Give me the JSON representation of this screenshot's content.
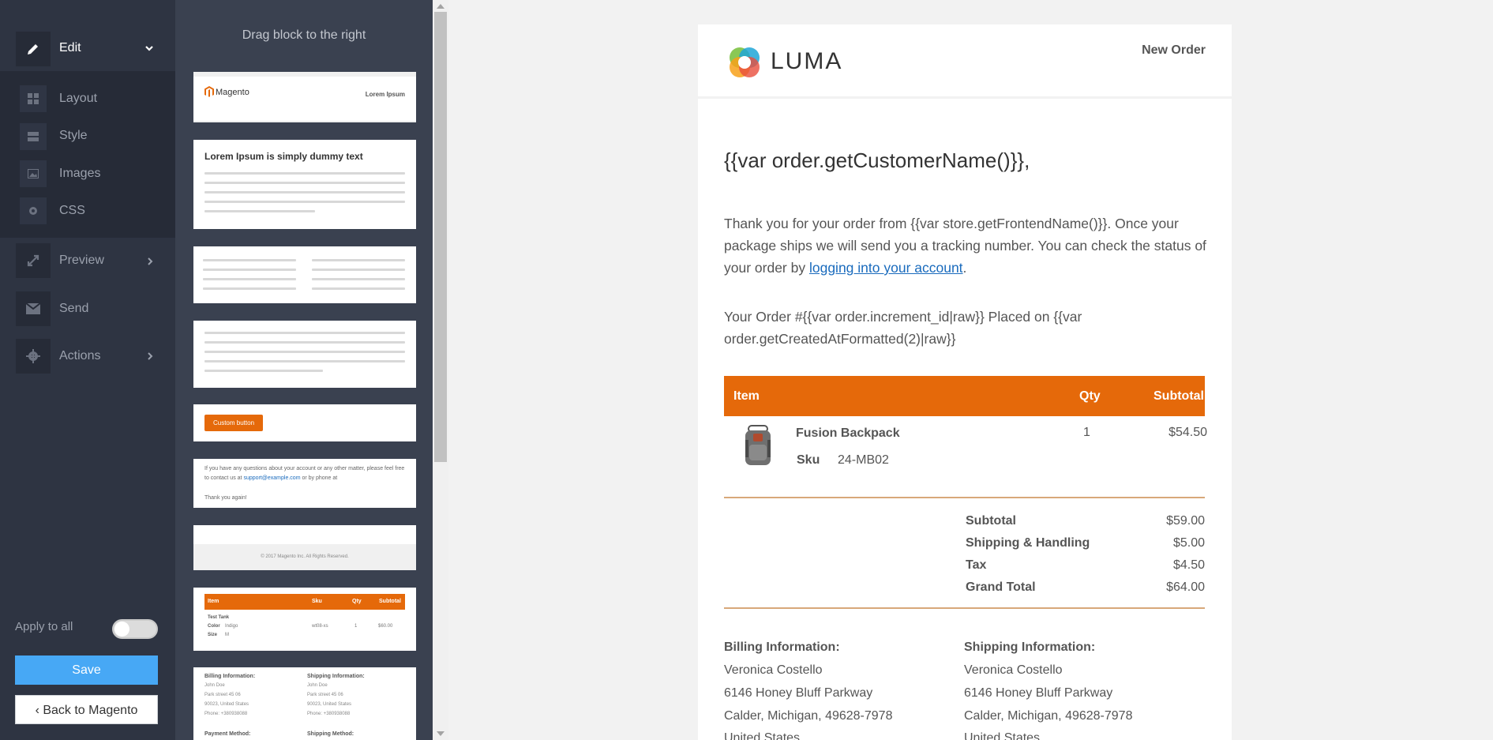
{
  "nav": {
    "edit": "Edit",
    "layout": "Layout",
    "style": "Style",
    "images": "Images",
    "css": "CSS",
    "preview": "Preview",
    "send": "Send",
    "actions": "Actions",
    "apply_to_all": "Apply to all",
    "apply_to_all_on": false,
    "save": "Save",
    "back": "Back to Magento"
  },
  "palette": {
    "hint": "Drag block to the right",
    "header_block": {
      "logo": "Magento",
      "right_text": "Lorem Ipsum"
    },
    "text_block_title": "Lorem Ipsum is simply dummy text",
    "button_block": {
      "label": "Custom button"
    },
    "contact_block": {
      "line1": "If you have any questions about your account or any other matter, please feel free to",
      "line2_pre": "contact us at ",
      "email": "support@example.com",
      "line2_post": " or by phone at",
      "thanks": "Thank you again!"
    },
    "footer_block": {
      "text": "© 2017 Magento Inc. All Rights Reserved."
    },
    "items_block": {
      "cols": [
        "Item",
        "Sku",
        "Qty",
        "Subtotal"
      ],
      "name": "Test Tank",
      "color_label": "Color",
      "color": "Indigo",
      "size_label": "Size",
      "size": "M",
      "sku": "wt08-xs",
      "qty": "1",
      "subtotal": "$60.00"
    },
    "address_block": {
      "billing": "Billing Information:",
      "shipping": "Shipping Information:",
      "name": "John Doe",
      "street": "Park street 45 06",
      "city": "90023, United States",
      "phone": "Phone: +380938088",
      "payment": "Payment Method:",
      "shipping_method": "Shipping Method:"
    }
  },
  "email": {
    "logo": "LUMA",
    "new_order": "New Order",
    "greeting": "{{var order.getCustomerName()}},",
    "thanks_pre": "Thank you for your order from {{var store.getFrontendName()}}. Once your package ships we will send you a tracking number. You can check the status of your order by ",
    "thanks_link": "logging into your account",
    "thanks_post": ".",
    "order_line": "Your Order #{{var order.increment_id|raw}} Placed on {{var order.getCreatedAtFormatted(2)|raw}}",
    "table": {
      "col_item": "Item",
      "col_qty": "Qty",
      "col_subtotal": "Subtotal"
    },
    "product": {
      "name": "Fusion Backpack",
      "sku_label": "Sku",
      "sku": "24-MB02",
      "qty": "1",
      "subtotal": "$54.50"
    },
    "totals": [
      {
        "label": "Subtotal",
        "value": "$59.00"
      },
      {
        "label": "Shipping & Handling",
        "value": "$5.00"
      },
      {
        "label": "Tax",
        "value": "$4.50"
      },
      {
        "label": "Grand Total",
        "value": "$64.00"
      }
    ],
    "billing": {
      "title": "Billing Information:",
      "name": "Veronica Costello",
      "street": "6146 Honey Bluff Parkway",
      "city": "Calder, Michigan, 49628-7978",
      "country": "United States"
    },
    "shipping": {
      "title": "Shipping Information:",
      "name": "Veronica Costello",
      "street": "6146 Honey Bluff Parkway",
      "city": "Calder, Michigan, 49628-7978",
      "country": "United States"
    }
  },
  "colors": {
    "accent": "#e5690a",
    "save_button": "#47a8f5",
    "nav_bg": "#2e3442",
    "palette_bg": "#3a4150"
  }
}
